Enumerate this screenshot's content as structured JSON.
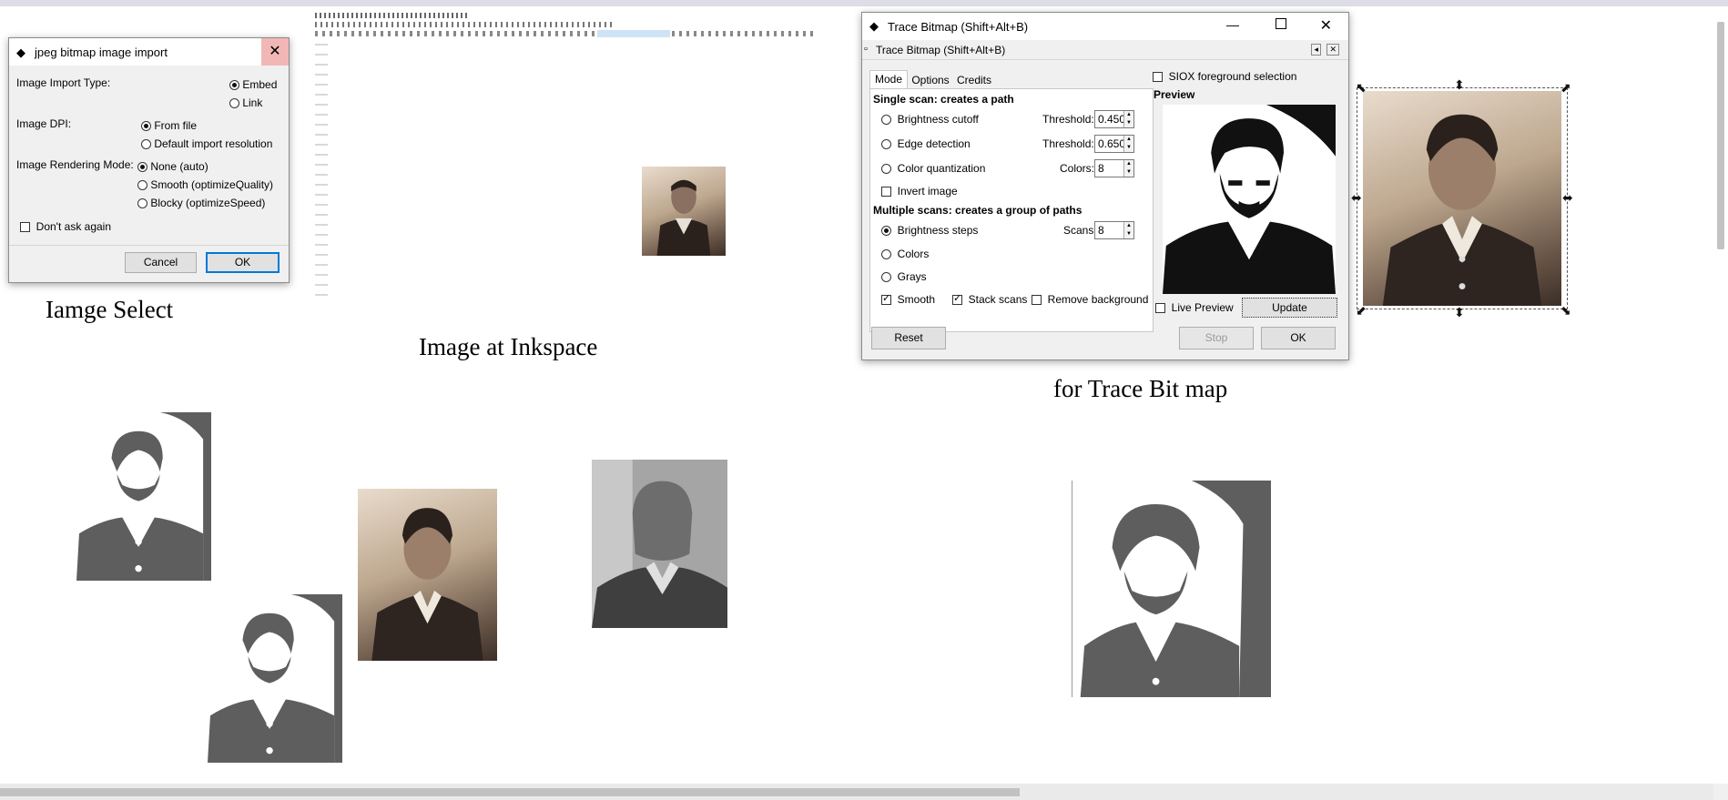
{
  "captions": {
    "image_select": "Iamge Select",
    "image_at_inkspace": "Image at Inkspace",
    "trace_bitmap": "for Trace Bit map"
  },
  "import_dialog": {
    "title": "jpeg bitmap image import",
    "import_type_label": "Image Import Type:",
    "embed": "Embed",
    "link": "Link",
    "dpi_label": "Image DPI:",
    "from_file": "From file",
    "default_res": "Default import resolution",
    "rendering_label": "Image Rendering Mode:",
    "none_auto": "None (auto)",
    "smooth": "Smooth (optimizeQuality)",
    "blocky": "Blocky (optimizeSpeed)",
    "dont_ask": "Don't ask again",
    "cancel": "Cancel",
    "ok": "OK"
  },
  "trace_dialog": {
    "window_title": "Trace Bitmap (Shift+Alt+B)",
    "panel_title": "Trace Bitmap (Shift+Alt+B)",
    "tabs": [
      "Mode",
      "Options",
      "Credits"
    ],
    "single_scan": "Single scan: creates a path",
    "brightness_cutoff": "Brightness cutoff",
    "threshold_label": "Threshold:",
    "brightness_threshold": "0.450",
    "edge_detection": "Edge detection",
    "edge_threshold": "0.650",
    "color_quantization": "Color quantization",
    "colors_label": "Colors:",
    "colors_value": "8",
    "invert_image": "Invert image",
    "multiple_scans": "Multiple scans: creates a group of paths",
    "brightness_steps": "Brightness steps",
    "scans_label": "Scans:",
    "scans_value": "8",
    "colors": "Colors",
    "grays": "Grays",
    "smooth": "Smooth",
    "stack_scans": "Stack scans",
    "remove_background": "Remove background",
    "siox": "SIOX foreground selection",
    "preview": "Preview",
    "live_preview": "Live Preview",
    "update": "Update",
    "reset": "Reset",
    "stop": "Stop",
    "ok": "OK"
  },
  "colors": {
    "accent": "#0078d7",
    "trace_gray": "#5e5e5e",
    "sepia_dark": "#3c2f27"
  }
}
